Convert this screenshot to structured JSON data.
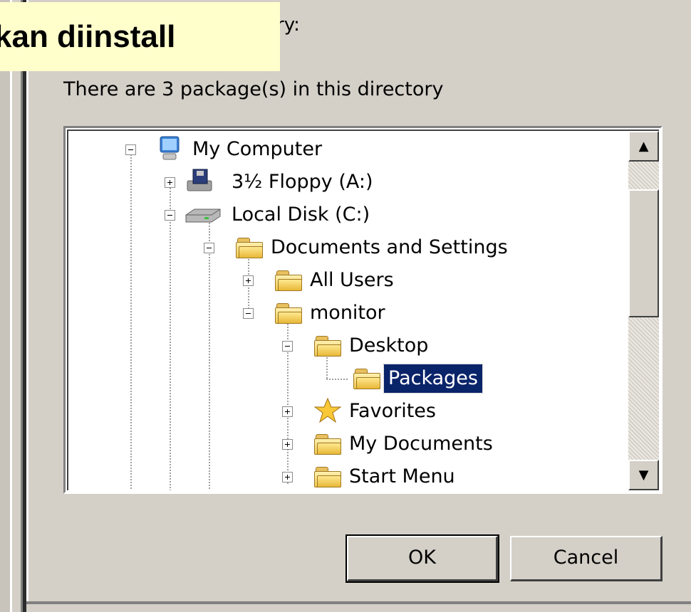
{
  "overlay": {
    "caption": "kan diinstall"
  },
  "dialog": {
    "directory_label_tail": "ry:",
    "package_count": "There are 3 package(s) in this directory",
    "ok_label": "OK",
    "cancel_label": "Cancel"
  },
  "tree": {
    "items": [
      {
        "label": "My Computer",
        "icon": "computer-icon",
        "expander": "minus"
      },
      {
        "label": "3½ Floppy (A:)",
        "icon": "floppy-drive-icon",
        "expander": "plus"
      },
      {
        "label": "Local Disk (C:)",
        "icon": "hard-disk-icon",
        "expander": "minus"
      },
      {
        "label": "Documents and Settings",
        "icon": "folder-open-icon",
        "expander": "minus"
      },
      {
        "label": "All Users",
        "icon": "folder-icon",
        "expander": "plus"
      },
      {
        "label": "monitor",
        "icon": "folder-open-icon",
        "expander": "minus"
      },
      {
        "label": "Desktop",
        "icon": "folder-open-icon",
        "expander": "minus"
      },
      {
        "label": "Packages",
        "icon": "folder-open-icon",
        "expander": "none",
        "selected": true
      },
      {
        "label": "Favorites",
        "icon": "star-icon",
        "expander": "plus"
      },
      {
        "label": "My Documents",
        "icon": "folder-icon",
        "expander": "plus"
      },
      {
        "label": "Start Menu",
        "icon": "folder-icon",
        "expander": "plus"
      }
    ]
  },
  "scrollbar": {
    "up_icon": "arrow-up-icon",
    "down_icon": "arrow-down-icon"
  }
}
